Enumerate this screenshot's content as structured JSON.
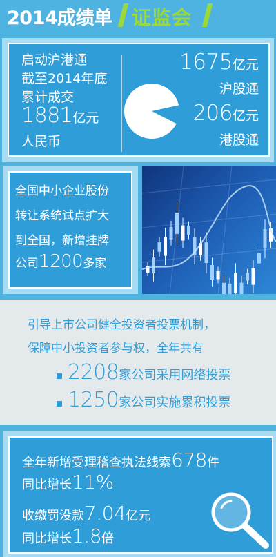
{
  "header": {
    "title": "2014成绩单",
    "org": "证监会"
  },
  "connect": {
    "line1": "启动沪港通",
    "line2": "截至2014年底",
    "line3": "累计成交",
    "total_num": "1881",
    "total_unit": "亿元",
    "line5": "人民币",
    "sh_num": "1675",
    "sh_unit": "亿元",
    "sh_label": "沪股通",
    "hk_num": "206",
    "hk_unit": "亿元",
    "hk_label": "港股通",
    "pie_shares": {
      "sh": 1675,
      "hk": 206
    }
  },
  "sme": {
    "line1": "全国中小企业股份",
    "line2": "转让系统试点扩大",
    "line3": "到全国，新增挂牌",
    "line4_pre": "公司",
    "line4_num": "1200",
    "line4_post": "多家"
  },
  "voting": {
    "head1": "引导上市公司健全投资者投票机制，",
    "head2": "保障中小投资者参与权，全年共有",
    "item1_num": "2208",
    "item1_text": "家公司采用网络投票",
    "item2_num": "1250",
    "item2_text": "家公司实施累积投票"
  },
  "enforcement": {
    "line1_pre": "全年新增受理稽查执法线索",
    "line1_num": "678",
    "line1_post": "件",
    "line2_pre": "同比增长",
    "line2_num": "11%",
    "line3_pre": "收缴罚没款",
    "line3_num": "7.04",
    "line3_post": "亿元",
    "line4_pre": "同比增长",
    "line4_num": "1.8",
    "line4_post": "倍"
  },
  "colors": {
    "background": "#4fb3e2",
    "panel_blue": "#2f9ed8",
    "accent_green": "#9bd83a",
    "panel_gray": "#e4e9ec"
  },
  "icons": {
    "photo": "stock-candlestick-chart",
    "magnifier": "magnifying-glass-icon"
  }
}
